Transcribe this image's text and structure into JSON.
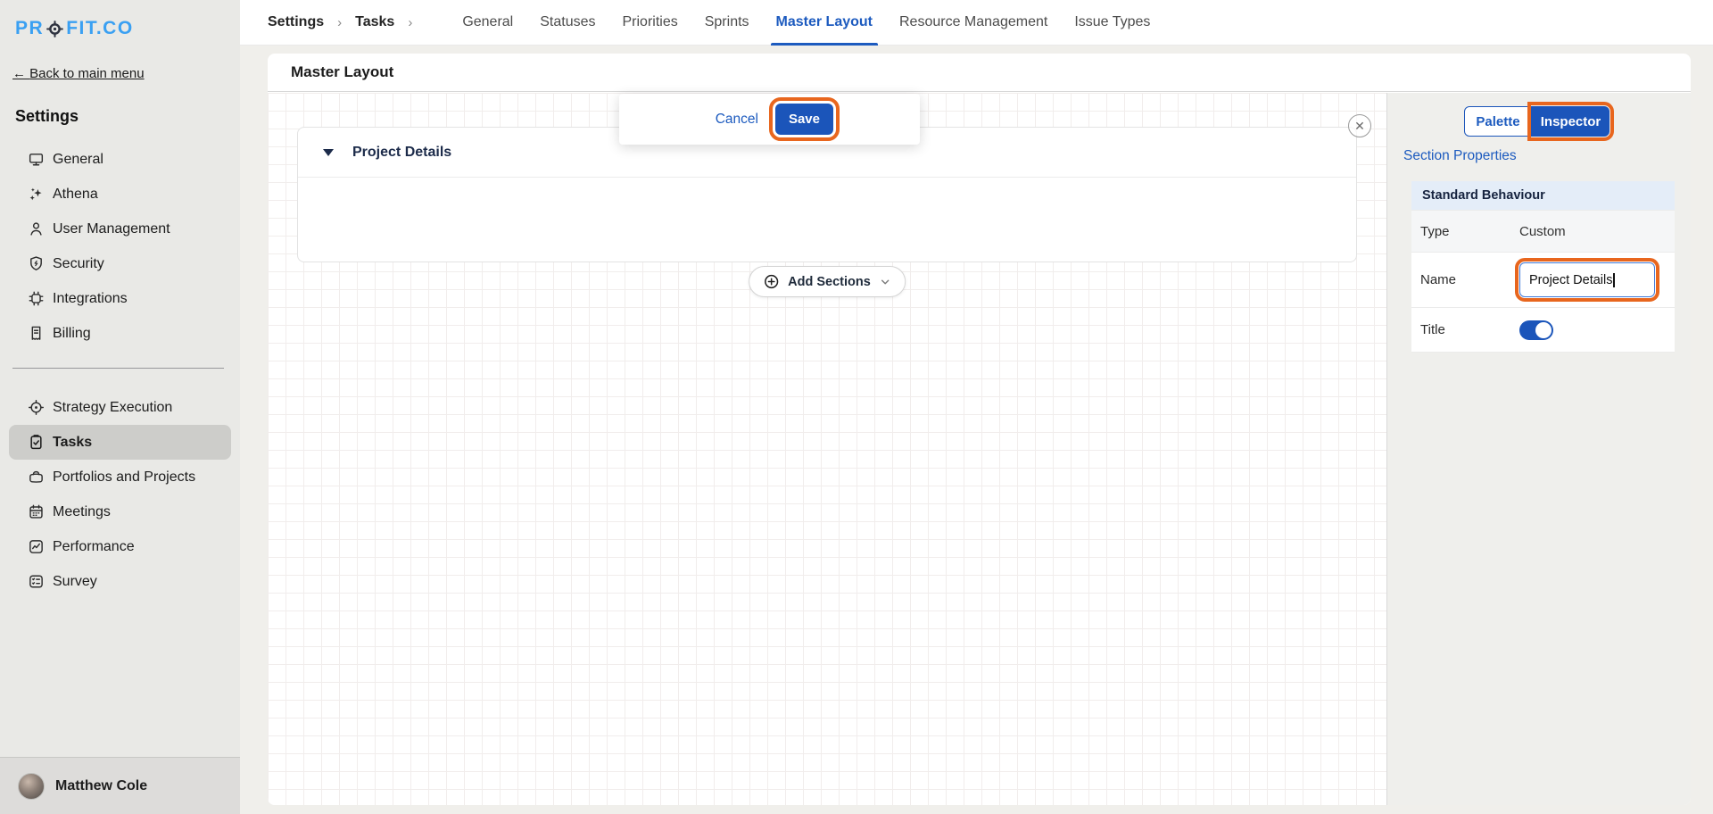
{
  "brand": {
    "logo_pre": "PR",
    "logo_post": "FIT.CO",
    "logo_icon": "target-icon",
    "logo_full": "PROFIT.CO"
  },
  "sidebar": {
    "back_arrow": "←",
    "back_label": "Back to main menu",
    "title": "Settings",
    "group1": [
      {
        "label": "General",
        "icon": "monitor-icon"
      },
      {
        "label": "Athena",
        "icon": "sparkles-icon"
      },
      {
        "label": "User Management",
        "icon": "user-icon"
      },
      {
        "label": "Security",
        "icon": "shield-icon"
      },
      {
        "label": "Integrations",
        "icon": "chip-icon"
      },
      {
        "label": "Billing",
        "icon": "receipt-icon"
      }
    ],
    "group2": [
      {
        "label": "Strategy Execution",
        "icon": "target-scope-icon"
      },
      {
        "label": "Tasks",
        "icon": "clipboard-check-icon",
        "active": true
      },
      {
        "label": "Portfolios and Projects",
        "icon": "briefcase-icon"
      },
      {
        "label": "Meetings",
        "icon": "calendar-icon"
      },
      {
        "label": "Performance",
        "icon": "chart-line-icon"
      },
      {
        "label": "Survey",
        "icon": "survey-list-icon"
      }
    ],
    "user": {
      "name": "Matthew Cole"
    }
  },
  "topnav": {
    "breadcrumb": [
      {
        "label": "Settings"
      },
      {
        "label": "Tasks"
      }
    ],
    "separator": "›",
    "tabs": [
      {
        "label": "General"
      },
      {
        "label": "Statuses"
      },
      {
        "label": "Priorities"
      },
      {
        "label": "Sprints"
      },
      {
        "label": "Master Layout",
        "active": true
      },
      {
        "label": "Resource Management"
      },
      {
        "label": "Issue Types"
      }
    ]
  },
  "page": {
    "title": "Master Layout"
  },
  "toolbar": {
    "cancel_label": "Cancel",
    "save_label": "Save"
  },
  "canvas": {
    "section_title": "Project Details",
    "add_sections_label": "Add Sections",
    "close_glyph": "✕"
  },
  "inspector_panel": {
    "tabs": {
      "palette": "Palette",
      "inspector": "Inspector",
      "active": "Inspector"
    },
    "title": "Section Properties",
    "group_header": "Standard Behaviour",
    "fields": {
      "type": {
        "label": "Type",
        "value": "Custom"
      },
      "name": {
        "label": "Name",
        "value": "Project Details"
      },
      "title": {
        "label": "Title",
        "value": "on"
      }
    }
  },
  "colors": {
    "accent_blue": "#1b55ba",
    "link_blue": "#1d5bbf",
    "annotation_orange": "#e8661e"
  }
}
